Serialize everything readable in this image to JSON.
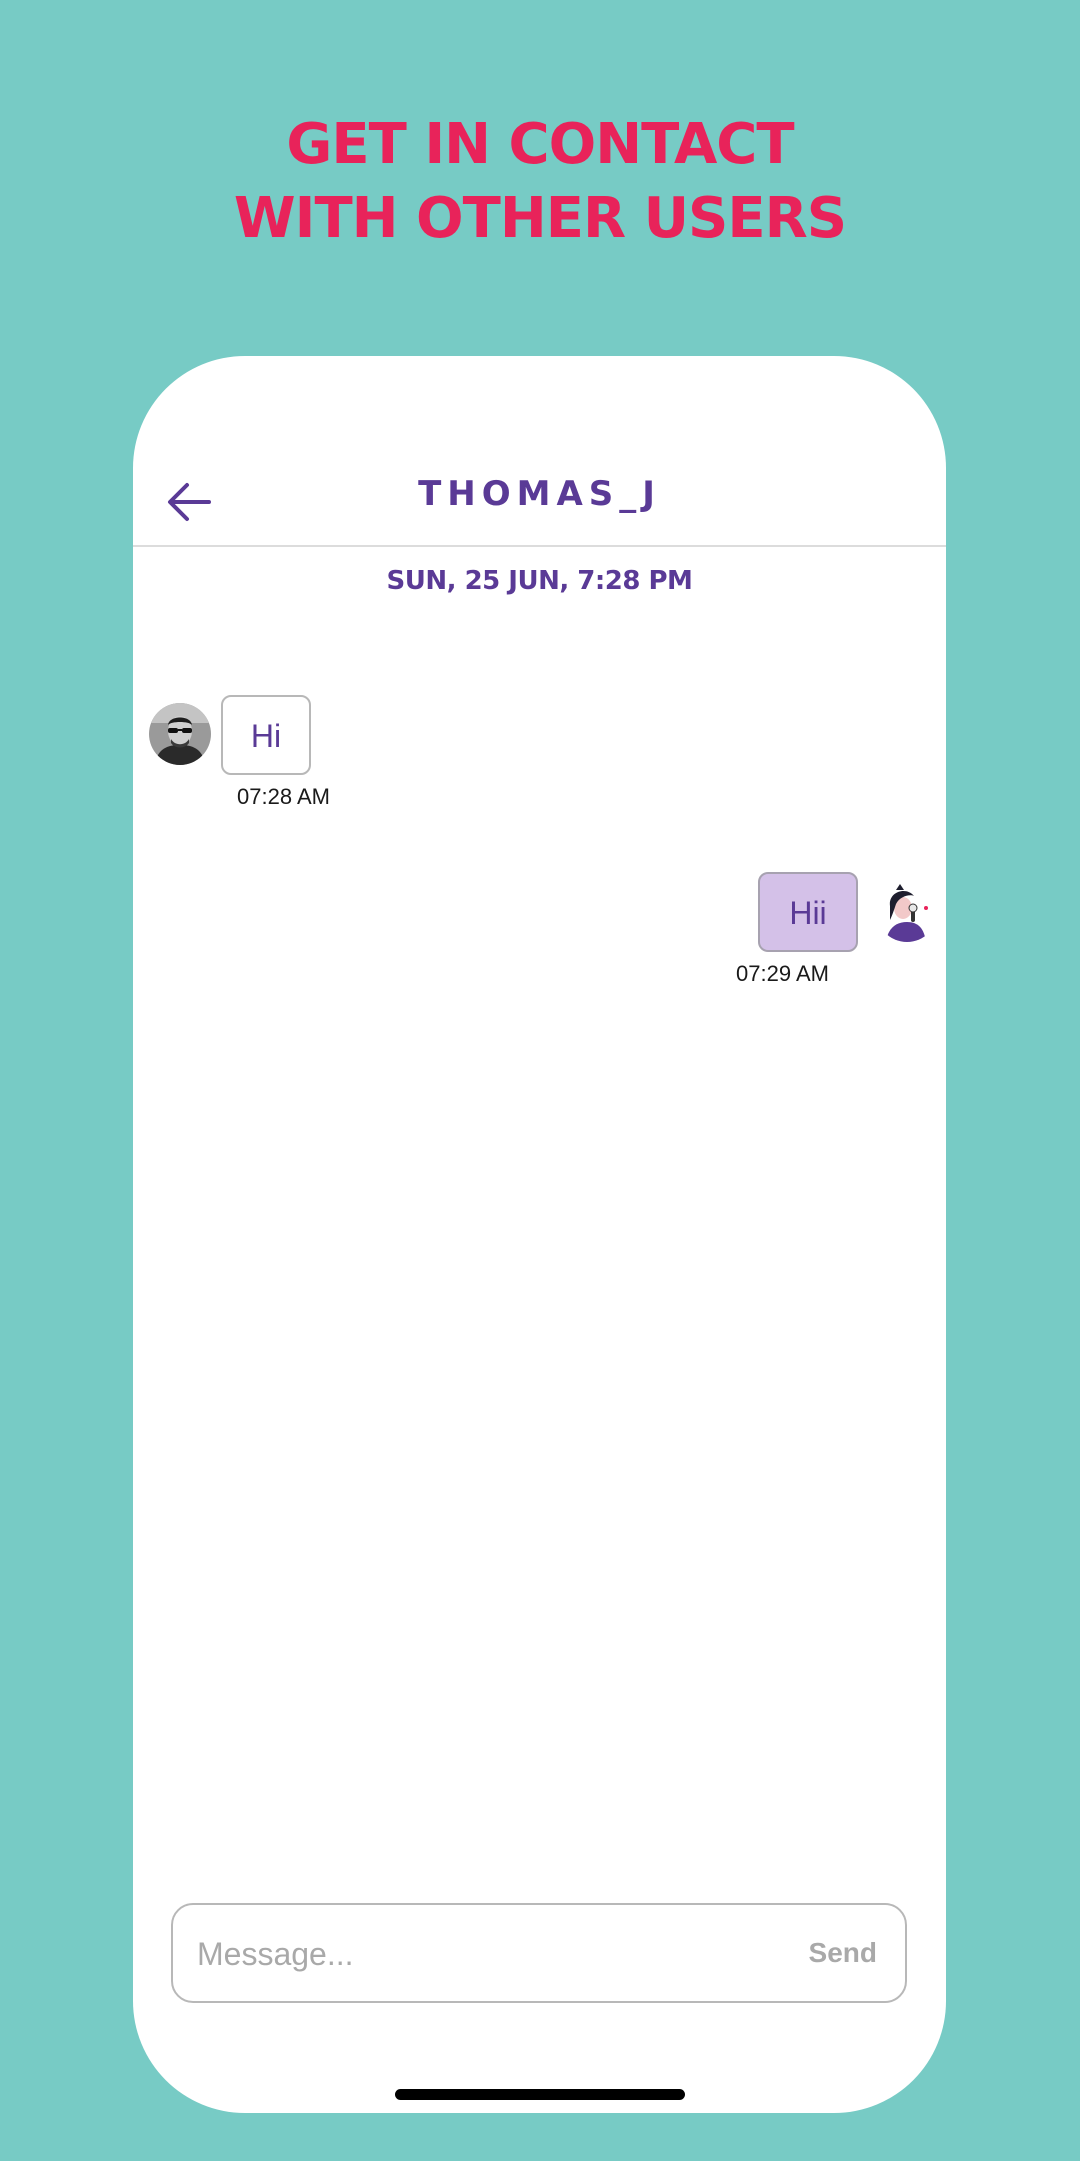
{
  "promo": {
    "line1": "GET IN CONTACT",
    "line2": "WITH OTHER USERS"
  },
  "header": {
    "back_icon": "arrow-left-icon",
    "title": "THOMAS_J"
  },
  "date_separator": "SUN, 25 JUN, 7:28 PM",
  "messages": [
    {
      "direction": "incoming",
      "text": "Hi",
      "time": "07:28 AM",
      "avatar": "man-sunglasses-avatar"
    },
    {
      "direction": "outgoing",
      "text": "Hii",
      "time": "07:29 AM",
      "avatar": "woman-singer-avatar"
    }
  ],
  "composer": {
    "placeholder": "Message...",
    "send_label": "Send"
  },
  "colors": {
    "background": "#77cbc5",
    "promo_text": "#e8235a",
    "accent": "#5a3a96",
    "outgoing_bubble": "#d4c1e8"
  }
}
